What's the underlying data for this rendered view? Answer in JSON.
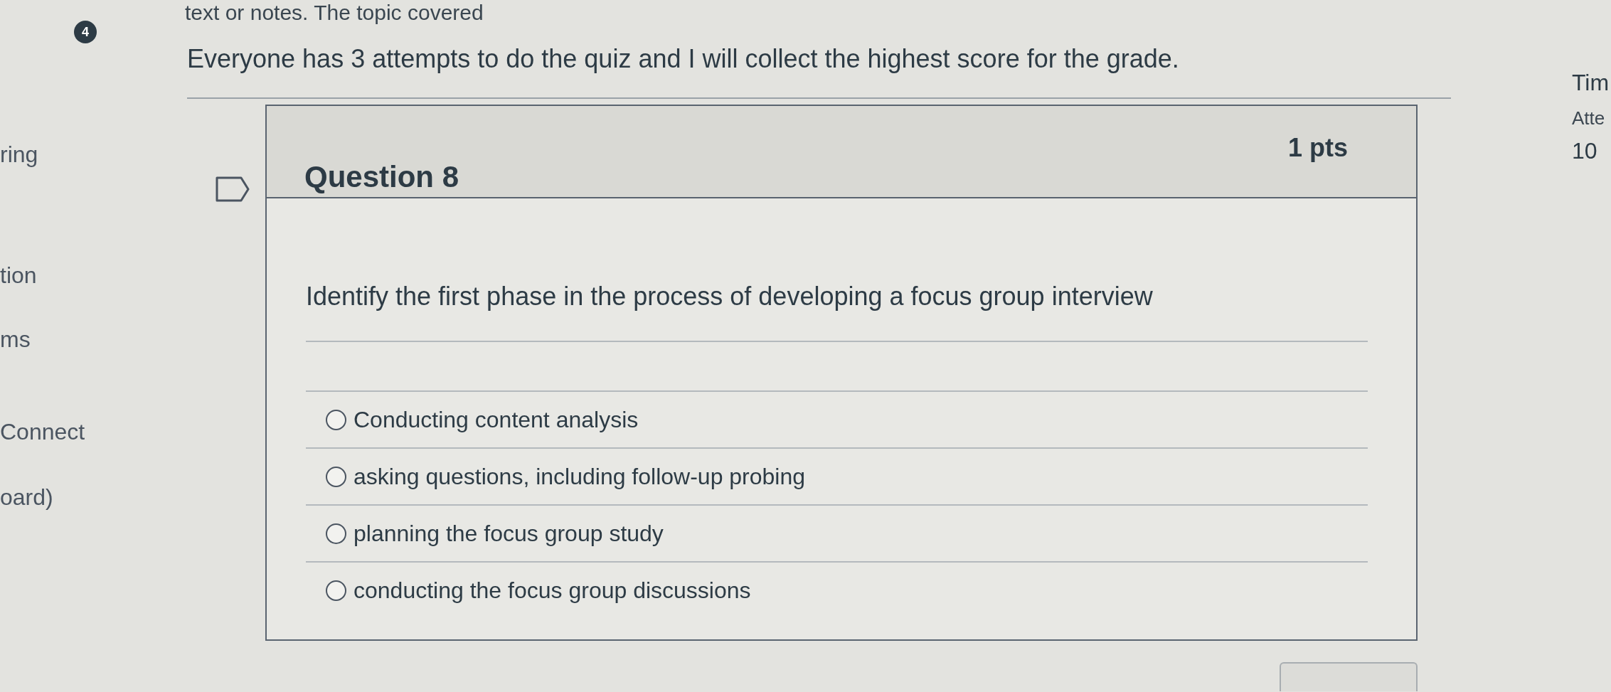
{
  "intro": {
    "badge": "4",
    "note": "text or notes. The topic covered",
    "instruction": "Everyone has 3 attempts to do the quiz and I will collect the highest score for the grade."
  },
  "sidebar_left": {
    "items": [
      "ring",
      "tion",
      "ms",
      "Connect",
      "oard)"
    ]
  },
  "sidebar_right": {
    "items": [
      {
        "kind": "heading",
        "text": "Tim"
      },
      {
        "kind": "label",
        "text": "Atte"
      },
      {
        "kind": "value",
        "text": "10"
      }
    ]
  },
  "question": {
    "flagged": false,
    "title": "Question 8",
    "points": "1 pts",
    "prompt": "Identify the first phase in the process of developing a focus group interview",
    "answers": [
      {
        "label": "Conducting content analysis",
        "selected": false
      },
      {
        "label": "asking questions, including follow-up probing",
        "selected": false
      },
      {
        "label": "planning the focus group study",
        "selected": false
      },
      {
        "label": "conducting the focus group discussions",
        "selected": false
      }
    ]
  }
}
